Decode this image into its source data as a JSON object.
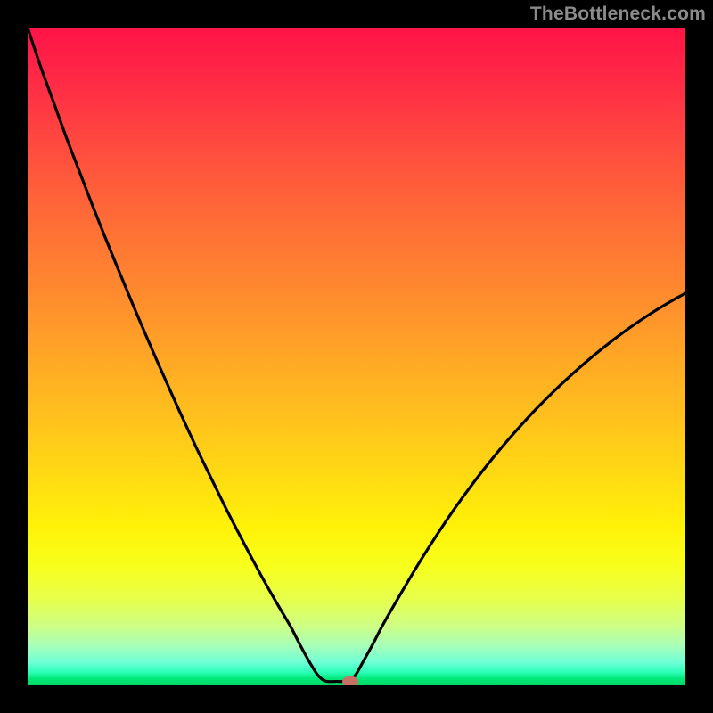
{
  "watermark": "TheBottleneck.com",
  "colors": {
    "frame": "#000000",
    "curve": "#000000",
    "marker": "#c77064"
  },
  "chart_data": {
    "type": "line",
    "title": "",
    "xlabel": "",
    "ylabel": "",
    "xlim": [
      0,
      100
    ],
    "ylim": [
      0,
      100
    ],
    "curve": [
      {
        "x": 0.0,
        "y": 100.0
      },
      {
        "x": 2.0,
        "y": 94.0
      },
      {
        "x": 4.0,
        "y": 88.5
      },
      {
        "x": 6.0,
        "y": 83.0
      },
      {
        "x": 8.0,
        "y": 77.8
      },
      {
        "x": 10.0,
        "y": 72.6
      },
      {
        "x": 12.0,
        "y": 67.6
      },
      {
        "x": 14.0,
        "y": 62.7
      },
      {
        "x": 16.0,
        "y": 57.9
      },
      {
        "x": 18.0,
        "y": 53.2
      },
      {
        "x": 20.0,
        "y": 48.6
      },
      {
        "x": 22.0,
        "y": 44.1
      },
      {
        "x": 24.0,
        "y": 39.7
      },
      {
        "x": 26.0,
        "y": 35.4
      },
      {
        "x": 28.0,
        "y": 31.3
      },
      {
        "x": 30.0,
        "y": 27.2
      },
      {
        "x": 32.0,
        "y": 23.3
      },
      {
        "x": 34.0,
        "y": 19.5
      },
      {
        "x": 36.0,
        "y": 15.8
      },
      {
        "x": 38.0,
        "y": 12.3
      },
      {
        "x": 40.0,
        "y": 8.9
      },
      {
        "x": 41.5,
        "y": 6.0
      },
      {
        "x": 43.0,
        "y": 3.3
      },
      {
        "x": 44.0,
        "y": 1.7
      },
      {
        "x": 44.8,
        "y": 0.9
      },
      {
        "x": 45.5,
        "y": 0.6
      },
      {
        "x": 47.0,
        "y": 0.6
      },
      {
        "x": 48.5,
        "y": 0.6
      },
      {
        "x": 49.3,
        "y": 0.9
      },
      {
        "x": 50.0,
        "y": 1.8
      },
      {
        "x": 51.0,
        "y": 3.6
      },
      {
        "x": 52.5,
        "y": 6.3
      },
      {
        "x": 54.0,
        "y": 9.2
      },
      {
        "x": 56.0,
        "y": 12.7
      },
      {
        "x": 58.0,
        "y": 16.1
      },
      {
        "x": 60.0,
        "y": 19.4
      },
      {
        "x": 62.5,
        "y": 23.3
      },
      {
        "x": 65.0,
        "y": 27.0
      },
      {
        "x": 68.0,
        "y": 31.1
      },
      {
        "x": 71.0,
        "y": 34.9
      },
      {
        "x": 74.0,
        "y": 38.4
      },
      {
        "x": 77.0,
        "y": 41.7
      },
      {
        "x": 80.0,
        "y": 44.7
      },
      {
        "x": 83.0,
        "y": 47.5
      },
      {
        "x": 86.0,
        "y": 50.1
      },
      {
        "x": 89.0,
        "y": 52.5
      },
      {
        "x": 92.0,
        "y": 54.7
      },
      {
        "x": 95.0,
        "y": 56.7
      },
      {
        "x": 98.0,
        "y": 58.5
      },
      {
        "x": 100.0,
        "y": 59.6
      }
    ],
    "marker": {
      "x": 49.0,
      "y": 0.6
    }
  }
}
